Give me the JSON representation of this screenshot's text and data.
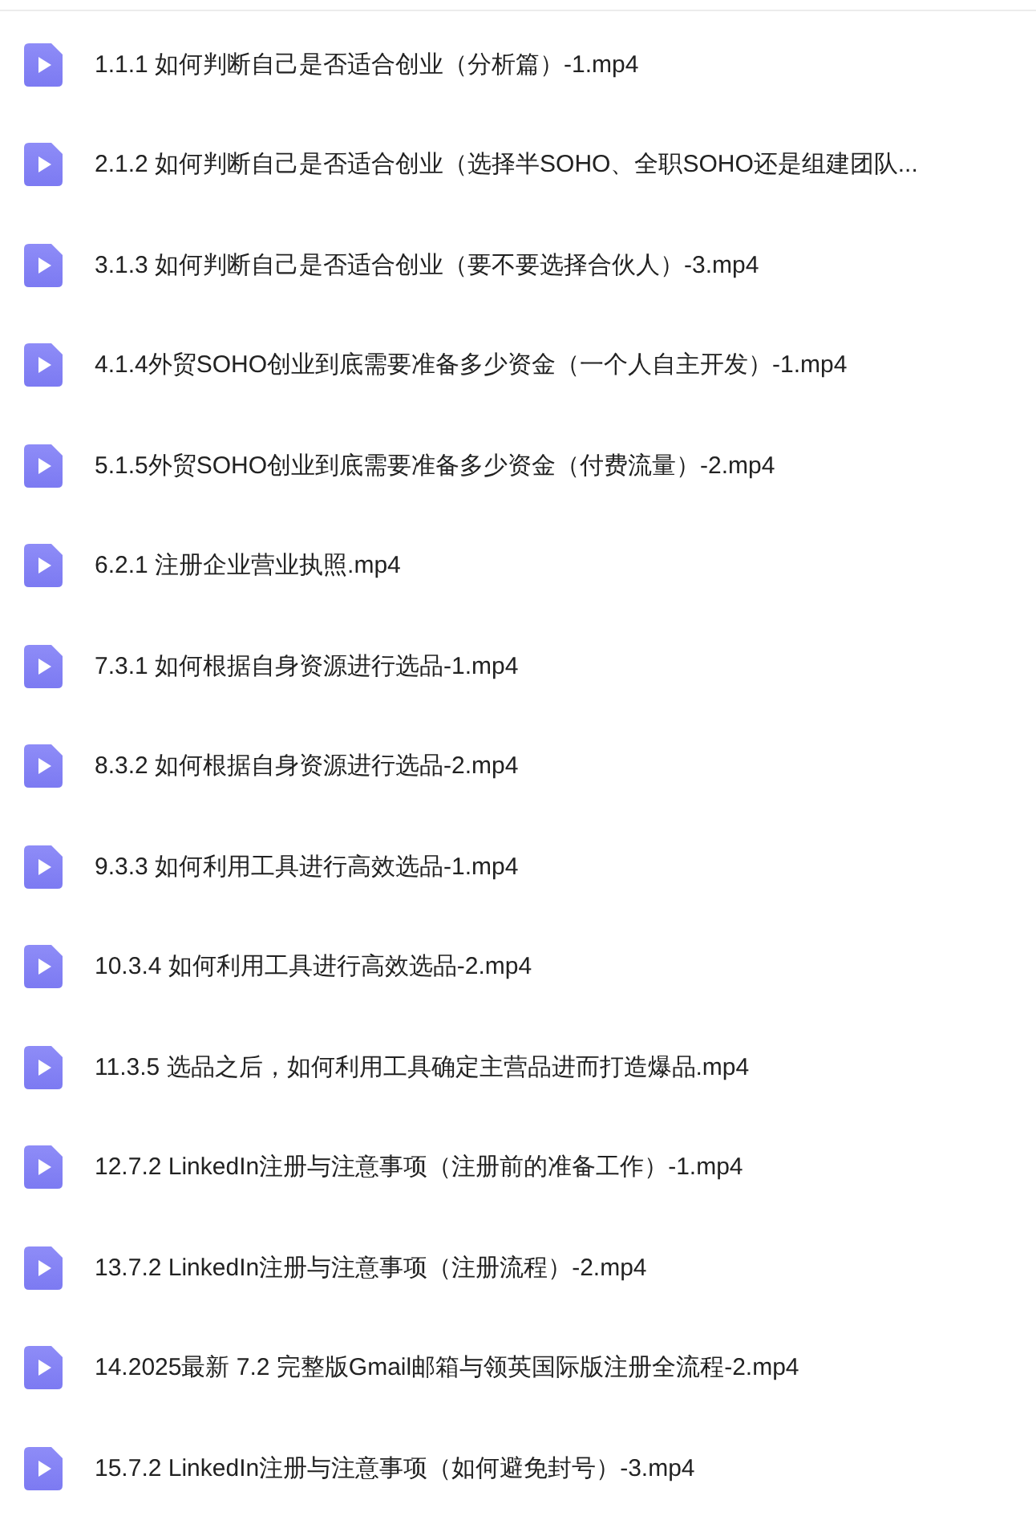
{
  "files": [
    {
      "name": "1.1.1 如何判断自己是否适合创业（分析篇）-1.mp4"
    },
    {
      "name": "2.1.2 如何判断自己是否适合创业（选择半SOHO、全职SOHO还是组建团队..."
    },
    {
      "name": "3.1.3 如何判断自己是否适合创业（要不要选择合伙人）-3.mp4"
    },
    {
      "name": "4.1.4外贸SOHO创业到底需要准备多少资金（一个人自主开发）-1.mp4"
    },
    {
      "name": "5.1.5外贸SOHO创业到底需要准备多少资金（付费流量）-2.mp4"
    },
    {
      "name": "6.2.1 注册企业营业执照.mp4"
    },
    {
      "name": "7.3.1 如何根据自身资源进行选品-1.mp4"
    },
    {
      "name": "8.3.2 如何根据自身资源进行选品-2.mp4"
    },
    {
      "name": "9.3.3 如何利用工具进行高效选品-1.mp4"
    },
    {
      "name": "10.3.4 如何利用工具进行高效选品-2.mp4"
    },
    {
      "name": "11.3.5 选品之后，如何利用工具确定主营品进而打造爆品.mp4"
    },
    {
      "name": "12.7.2 LinkedIn注册与注意事项（注册前的准备工作）-1.mp4"
    },
    {
      "name": "13.7.2 LinkedIn注册与注意事项（注册流程）-2.mp4"
    },
    {
      "name": "14.2025最新 7.2 完整版Gmail邮箱与领英国际版注册全流程-2.mp4"
    },
    {
      "name": "15.7.2 LinkedIn注册与注意事项（如何避免封号）-3.mp4"
    }
  ]
}
